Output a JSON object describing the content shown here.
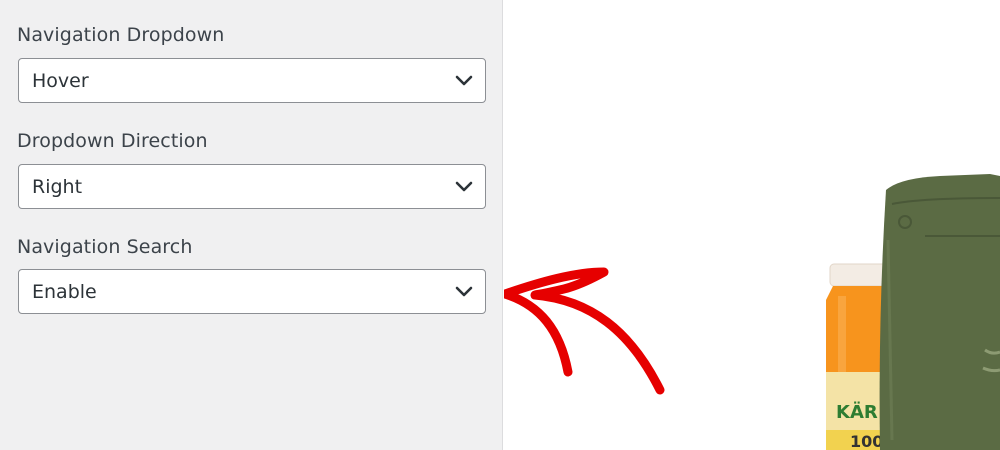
{
  "settings": {
    "navigation_dropdown": {
      "label": "Navigation Dropdown",
      "value": "Hover"
    },
    "dropdown_direction": {
      "label": "Dropdown Direction",
      "value": "Right"
    },
    "navigation_search": {
      "label": "Navigation Search",
      "value": "Enable"
    }
  },
  "preview": {
    "jar_label_text": "KÄR",
    "jar_number_text": "100"
  },
  "icons": {
    "select_caret": "chevron-down-icon",
    "annotation": "arrow-icon"
  },
  "colors": {
    "panel_bg": "#f0f0f1",
    "arrow": "#e60000",
    "jar": "#f7941d",
    "bag": "#5b6b44"
  }
}
